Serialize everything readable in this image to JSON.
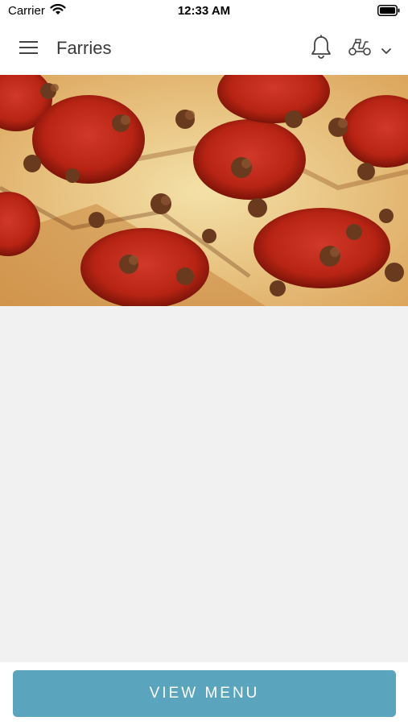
{
  "status_bar": {
    "carrier": "Carrier",
    "time": "12:33 AM",
    "icons": [
      "wifi-icon",
      "battery-icon"
    ]
  },
  "header": {
    "title": "Farries",
    "icons": [
      "menu-icon",
      "bell-icon",
      "scooter-icon",
      "chevron-down-icon"
    ]
  },
  "hero": {
    "image": "pepperoni-and-sausage-pizza"
  },
  "footer": {
    "view_menu_label": "VIEW MENU"
  },
  "colors": {
    "accent": "#5ba4bd",
    "background": "#f1f1f1",
    "header_background": "#ffffff",
    "title_text": "#3a3a3a"
  }
}
